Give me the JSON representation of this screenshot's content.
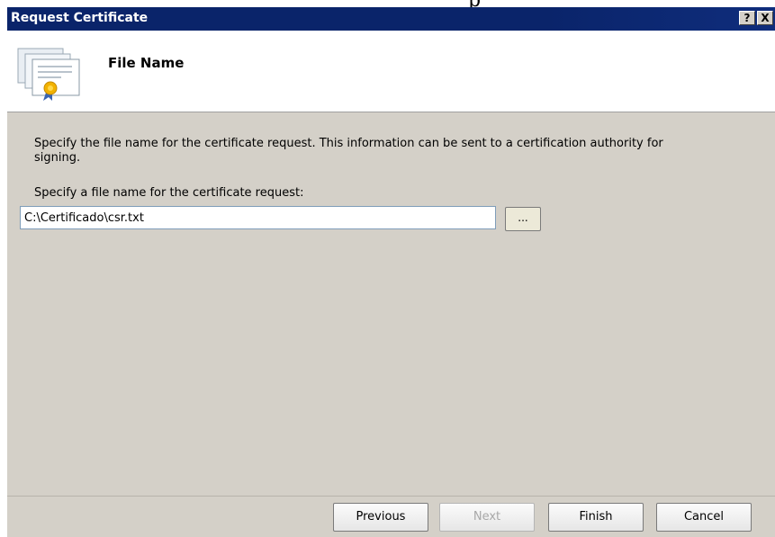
{
  "page_fragment": "p",
  "window": {
    "title": "Request Certificate",
    "help_label": "?",
    "close_label": "X"
  },
  "header": {
    "title": "File Name",
    "icon": "certificate-icon"
  },
  "content": {
    "description": "Specify the file name for the certificate request. This information can be sent to a certification authority for signing.",
    "field_label": "Specify a file name for the certificate request:",
    "file_value": "C:\\Certificado\\csr.txt",
    "browse_label": "..."
  },
  "buttons": {
    "previous": "Previous",
    "next": "Next",
    "finish": "Finish",
    "cancel": "Cancel"
  },
  "colors": {
    "titlebar": "#0a246a",
    "dialog_bg": "#d4d0c8",
    "header_bg": "#ffffff"
  }
}
